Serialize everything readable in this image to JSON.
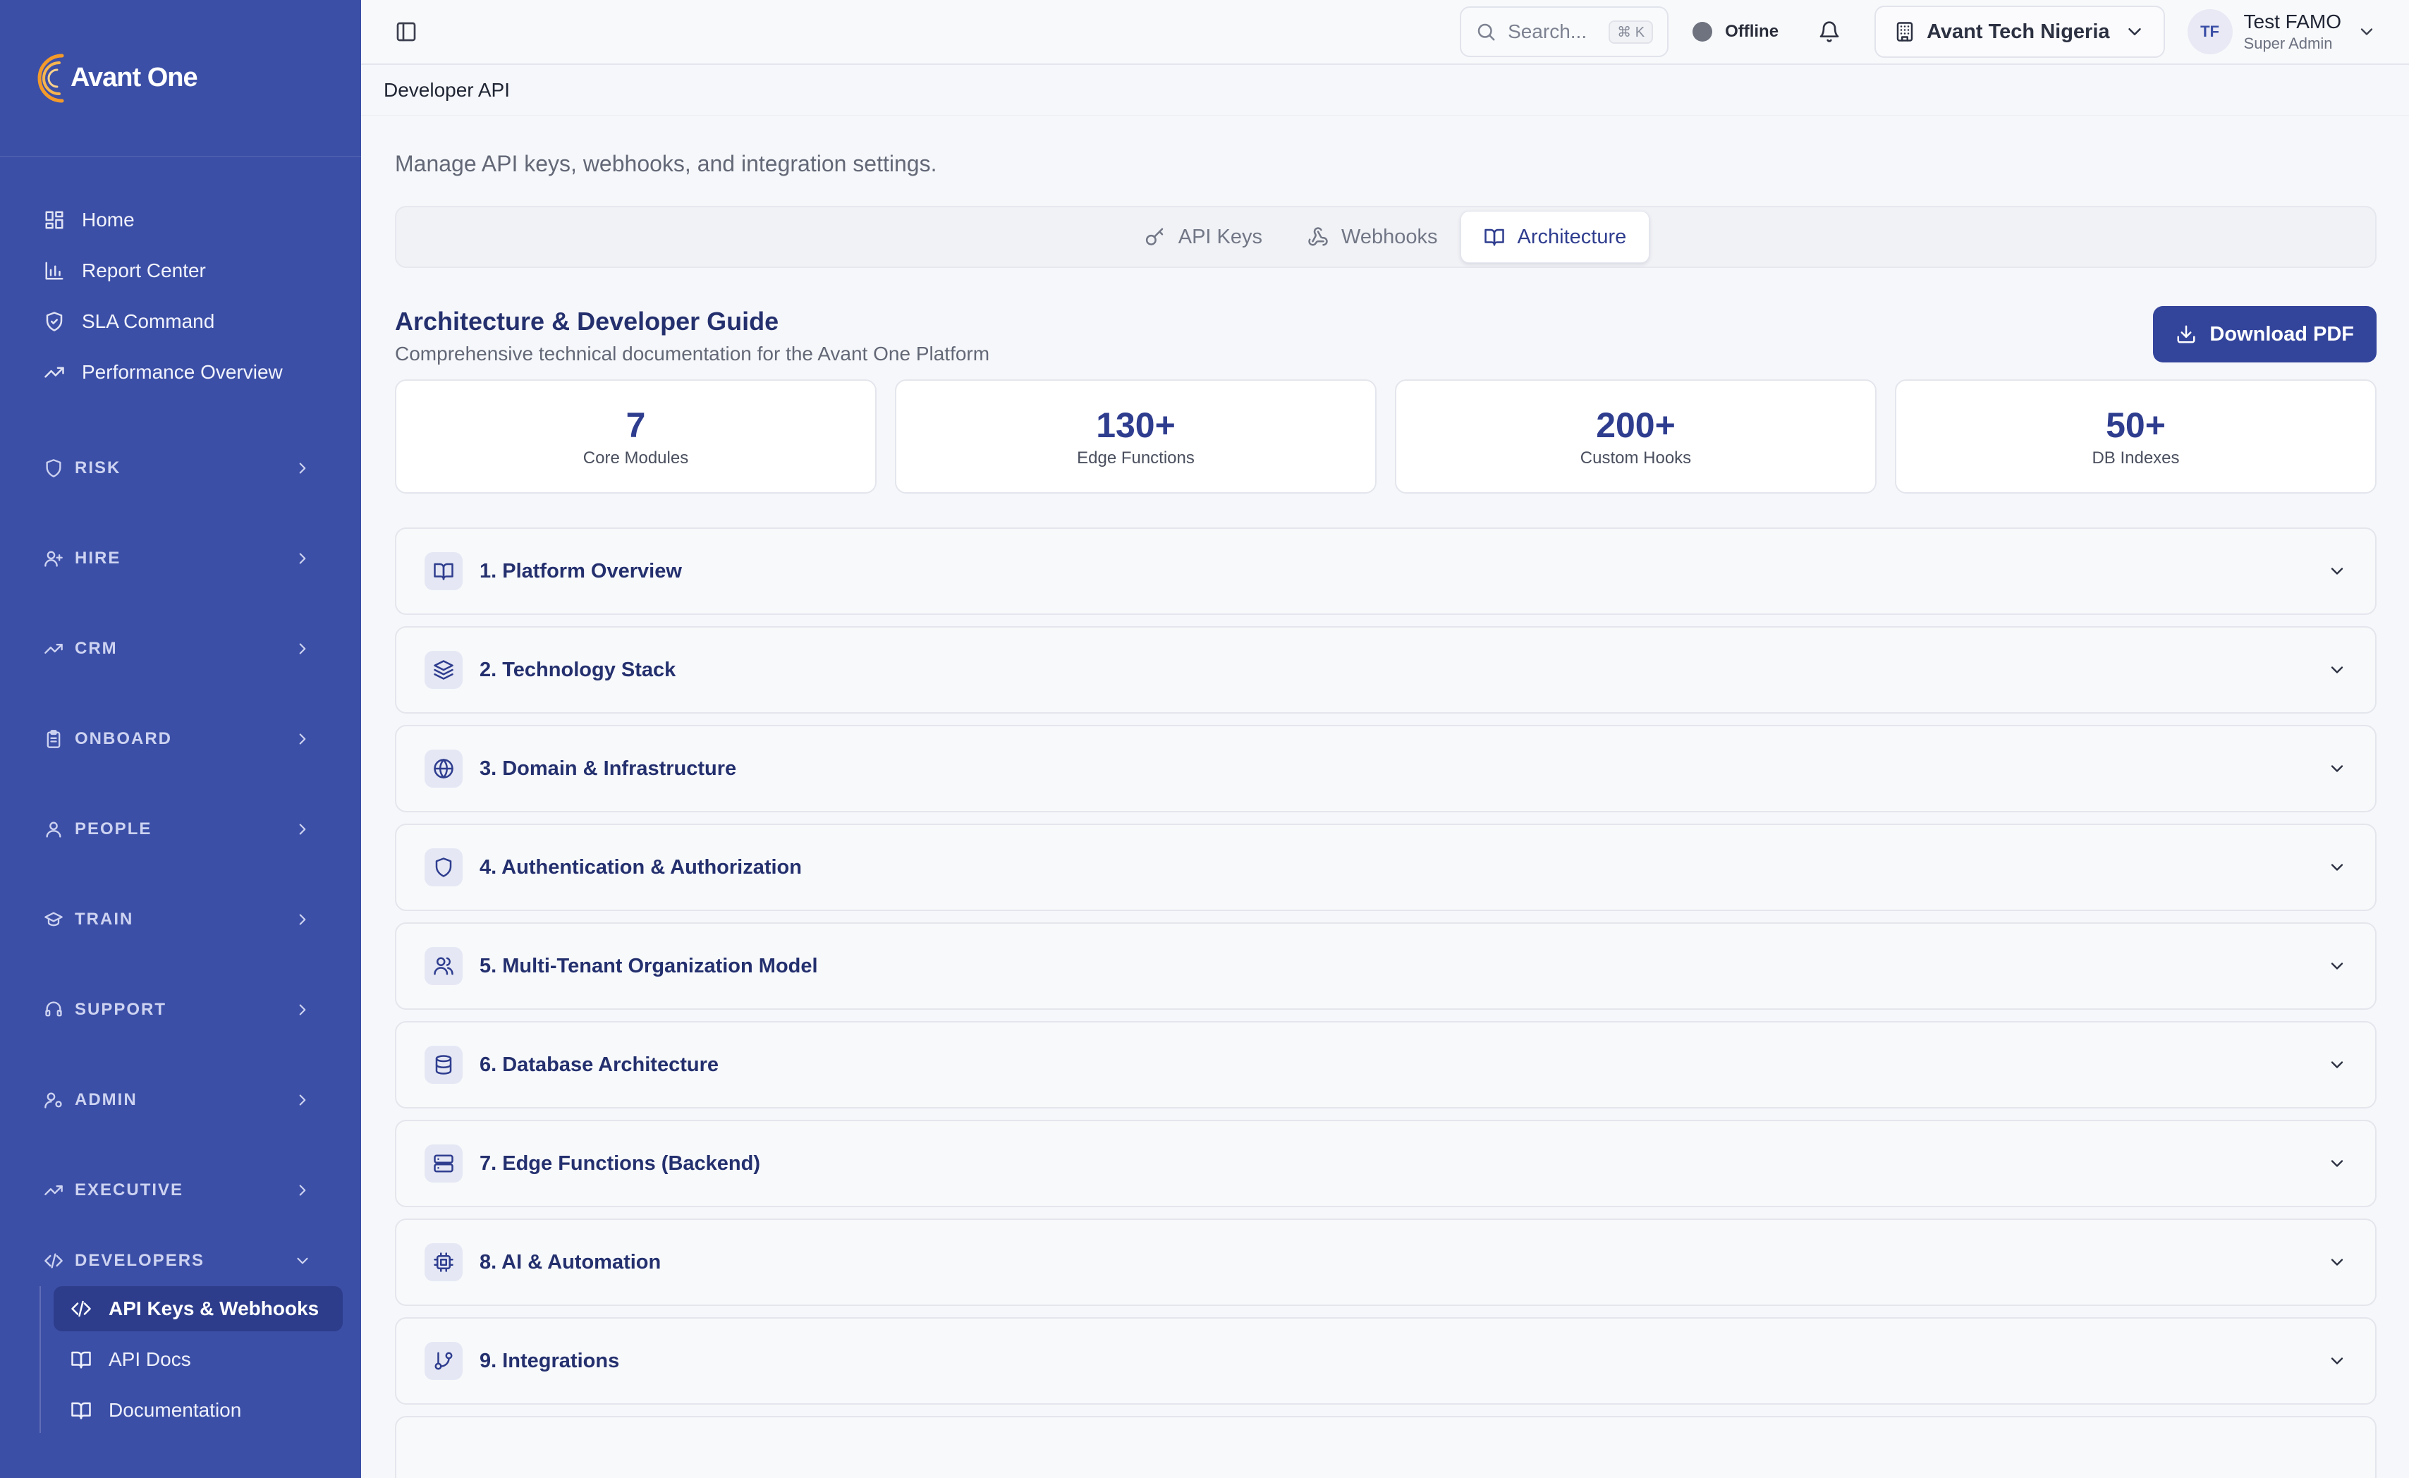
{
  "brand": {
    "logo_text": "Avant One",
    "accent": "#3c4fa6",
    "logo_orange": "#f39a2a"
  },
  "sidebar": {
    "top_items": [
      {
        "label": "Home",
        "icon": "grid-icon"
      },
      {
        "label": "Report Center",
        "icon": "bar-chart-icon"
      },
      {
        "label": "SLA Command",
        "icon": "shield-check-icon"
      },
      {
        "label": "Performance Overview",
        "icon": "trend-icon"
      }
    ],
    "sections": [
      {
        "label": "RISK",
        "icon": "shield-icon"
      },
      {
        "label": "HIRE",
        "icon": "user-plus-icon"
      },
      {
        "label": "CRM",
        "icon": "trend-icon"
      },
      {
        "label": "ONBOARD",
        "icon": "clipboard-icon"
      },
      {
        "label": "PEOPLE",
        "icon": "user-icon"
      },
      {
        "label": "TRAIN",
        "icon": "graduation-cap-icon"
      },
      {
        "label": "SUPPORT",
        "icon": "headset-icon"
      },
      {
        "label": "ADMIN",
        "icon": "user-cog-icon"
      },
      {
        "label": "EXECUTIVE",
        "icon": "trend-icon"
      }
    ],
    "developers": {
      "label": "DEVELOPERS",
      "items": [
        {
          "label": "API Keys & Webhooks",
          "active": true
        },
        {
          "label": "API Docs",
          "active": false
        },
        {
          "label": "Documentation",
          "active": false
        }
      ]
    }
  },
  "topbar": {
    "search_placeholder": "Search...",
    "search_shortcut": "⌘ K",
    "status": "Offline",
    "org_name": "Avant Tech Nigeria",
    "user": {
      "initials": "TF",
      "name": "Test FAMO",
      "role": "Super Admin"
    }
  },
  "breadcrumb": "Developer API",
  "page": {
    "subtitle": "Manage API keys, webhooks, and integration settings.",
    "tabs": [
      {
        "label": "API Keys",
        "active": false
      },
      {
        "label": "Webhooks",
        "active": false
      },
      {
        "label": "Architecture",
        "active": true
      }
    ],
    "guide": {
      "title": "Architecture & Developer Guide",
      "subtitle": "Comprehensive technical documentation for the Avant One Platform",
      "download_label": "Download PDF"
    },
    "stats": [
      {
        "value": "7",
        "label": "Core Modules"
      },
      {
        "value": "130+",
        "label": "Edge Functions"
      },
      {
        "value": "200+",
        "label": "Custom Hooks"
      },
      {
        "value": "50+",
        "label": "DB Indexes"
      }
    ],
    "sections": [
      {
        "title": "1. Platform Overview",
        "icon": "book-icon"
      },
      {
        "title": "2. Technology Stack",
        "icon": "layers-icon"
      },
      {
        "title": "3. Domain & Infrastructure",
        "icon": "globe-icon"
      },
      {
        "title": "4. Authentication & Authorization",
        "icon": "shield-icon"
      },
      {
        "title": "5. Multi-Tenant Organization Model",
        "icon": "users-icon"
      },
      {
        "title": "6. Database Architecture",
        "icon": "database-icon"
      },
      {
        "title": "7. Edge Functions (Backend)",
        "icon": "server-icon"
      },
      {
        "title": "8. AI & Automation",
        "icon": "cpu-icon"
      },
      {
        "title": "9. Integrations",
        "icon": "git-branch-icon"
      }
    ]
  }
}
